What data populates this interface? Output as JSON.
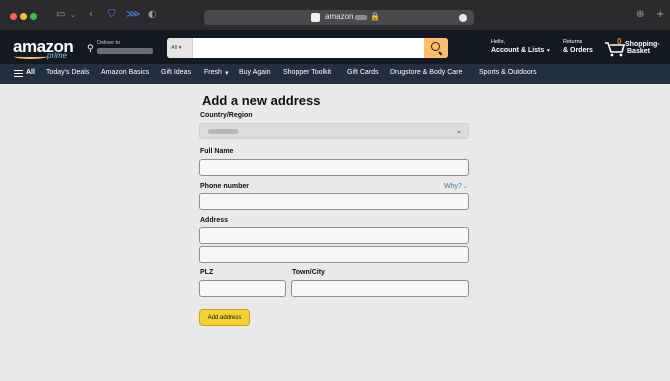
{
  "browser": {
    "url_text": "amazon",
    "lock_glyph": "🔒",
    "traffic_colors": [
      "#ff5f57",
      "#febc2e",
      "#28c840"
    ],
    "icons": [
      "sidebar-icon",
      "back-icon",
      "shield-icon",
      "tracker-icon",
      "contrast-icon",
      "download-icon",
      "new-tab-icon"
    ]
  },
  "header": {
    "logo": "amazon",
    "logo_sub": "prime",
    "deliver_label": "Deliver to",
    "search_category": "All",
    "search_placeholder": "",
    "hello": "Hello,",
    "account": "Account & Lists",
    "returns": "Returns",
    "orders": "& Orders",
    "cart_count": "0",
    "cart_line1": "Shopping-",
    "cart_line2": "Basket",
    "accent_color": "#febd69"
  },
  "nav": {
    "all": "All",
    "items": [
      "Today's Deals",
      "Amazon Basics",
      "Gift Ideas",
      "Fresh",
      "Buy Again",
      "Shopper Toolkit",
      "Gift Cards",
      "Drugstore & Body Care",
      "Sports & Outdoors"
    ]
  },
  "form": {
    "title": "Add a new address",
    "country_label": "Country/Region",
    "full_name_label": "Full Name",
    "phone_label": "Phone number",
    "why_link": "Why?",
    "address_label": "Address",
    "plz_label": "PLZ",
    "town_label": "Town/City",
    "submit": "Add address",
    "button_color": "#f5d132"
  }
}
